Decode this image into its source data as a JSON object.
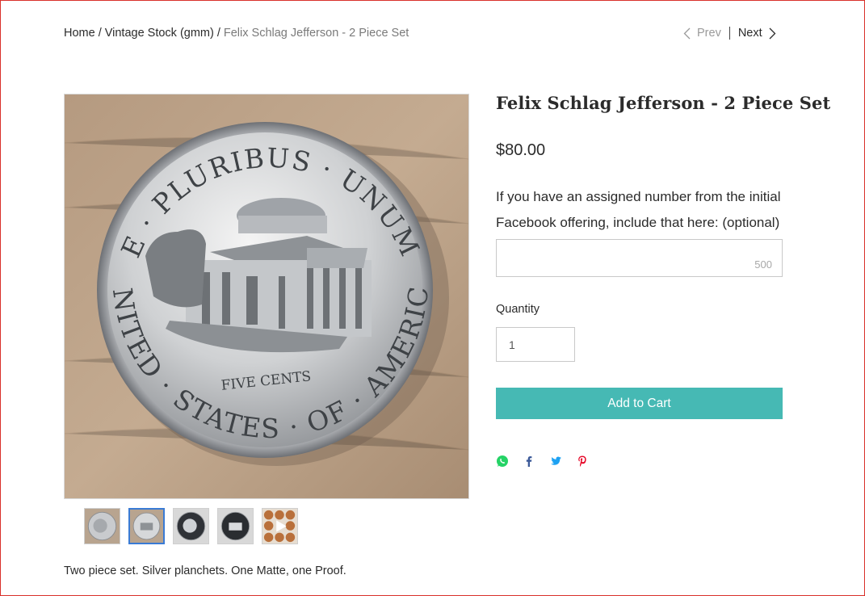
{
  "breadcrumb": {
    "home": "Home",
    "category": "Vintage Stock (gmm)",
    "current": "Felix Schlag Jefferson - 2 Piece Set",
    "separator": "/"
  },
  "pager": {
    "prev_label": "Prev",
    "next_label": "Next"
  },
  "product": {
    "title": "Felix Schlag Jefferson - 2 Piece Set",
    "price": "$80.00",
    "custom_text_label": "If you have an assigned number from the initial Facebook offering, include that here: (optional)",
    "custom_text_value": "",
    "custom_text_counter": "500",
    "quantity_label": "Quantity",
    "quantity_value": "1",
    "add_to_cart_label": "Add to Cart",
    "description": "Two piece set. Silver planchets. One Matte, one Proof."
  },
  "gallery": {
    "main_image": "coin-reverse-monticello",
    "coin_text": {
      "top": "E · PLURIBUS · UNUM",
      "bottom": "UNITED · STATES · OF · AMERICA",
      "center": "FIVE CENTS"
    },
    "thumbnails": [
      {
        "name": "matte-obverse",
        "selected": false
      },
      {
        "name": "matte-reverse",
        "selected": true
      },
      {
        "name": "proof-obverse",
        "selected": false
      },
      {
        "name": "proof-reverse",
        "selected": false
      },
      {
        "name": "video-copper-coins",
        "selected": false
      }
    ]
  },
  "share": {
    "icons": [
      "whatsapp-icon",
      "facebook-icon",
      "twitter-icon",
      "pinterest-icon"
    ]
  },
  "colors": {
    "accent": "#46b9b4",
    "border_frame": "#d9312b",
    "whatsapp": "#25d366",
    "facebook": "#3b5998",
    "twitter": "#1da1f2",
    "pinterest": "#e60023"
  }
}
